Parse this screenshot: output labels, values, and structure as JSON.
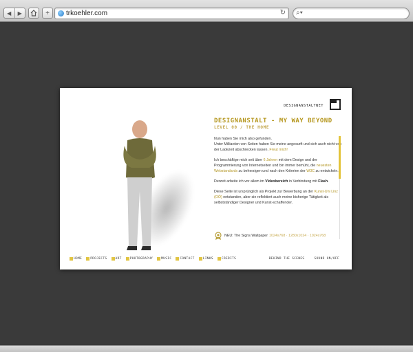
{
  "browser": {
    "url": "trkoehler.com",
    "icons": {
      "back": "chevron-left-icon",
      "forward": "chevron-right-icon",
      "home": "home-icon",
      "add": "plus-icon",
      "reload": "reload-icon",
      "search": "search-icon",
      "site": "globe-icon"
    }
  },
  "site": {
    "brand": "DESIGNANSTALTNET",
    "title": "DESIGNANSTALT - MY WAY BEYOND",
    "subtitle": "LEVEL 00 / THE HOME",
    "paragraphs": [
      {
        "p1": "Nun haben Sie mich also gefunden.",
        "p2": "Unter Milliarden von Seiten haben Sie meine angesurft und sich auch nicht von der Ladezeit abschrecken lassen.",
        "hl": "Freut mich!"
      }
    ],
    "para2": {
      "a": "Ich beschäftige mich seit über",
      "hl1": "6 Jahren",
      "b": "mit dem Design und der Programmierung von Internetseiten und bin immer bemüht, die",
      "hl2": "neuesten Webstandards",
      "c": "zu beherzigen und nach den Kriterien der",
      "hl3": "W3C",
      "d": "zu entwickeln."
    },
    "para3": {
      "a": "Derzeit arbeite ich vor allem im",
      "b1": "Videobereich",
      "b": "in Verbindung mit",
      "b2": "Flash",
      "c": "."
    },
    "para4": {
      "a": "Diese Seite ist ursprünglich als Projekt zur Bewerbung an der",
      "hl": "Kunst-Uni Linz (OÖ)",
      "b": "entstanden, aber sie reflektiert auch meine bisherige Tätigkeit als selbstständiger Designer und Kunst-schaffender."
    },
    "news": {
      "label": "NEU: The Signs Wallpaper",
      "sizes": "1024x768 · 1280x1024 · 1024x768"
    },
    "nav": [
      "HOME",
      "PROJECTS",
      "ART",
      "PHOTOGRAPHY",
      "MUSIC",
      "CONTACT",
      "LINKS",
      "CREDITS"
    ],
    "nav_right": [
      "BEHIND THE SCENES",
      "SOUND ON/OFF"
    ],
    "colors": {
      "accent": "#b5961c",
      "nav_square": "#e1c442",
      "background": "#3a3a3a"
    }
  }
}
